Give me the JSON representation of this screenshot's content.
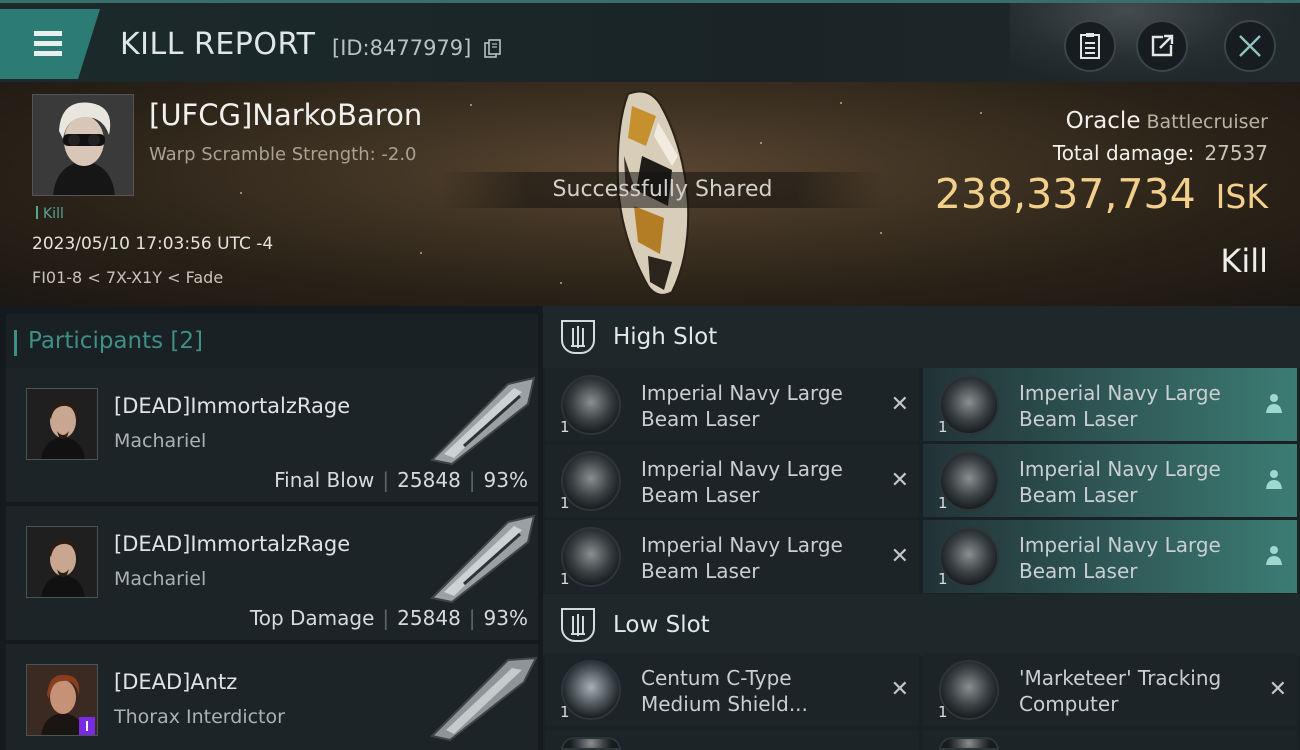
{
  "header": {
    "title": "KILL REPORT",
    "id_text": "[ID:8477979]"
  },
  "victim": {
    "name": "[UFCG]NarkoBaron",
    "warp_scramble": "Warp Scramble Strength: -2.0",
    "tag": "Kill",
    "datetime": "2023/05/10 17:03:56 UTC -4",
    "location": "FI01-8 < 7X-X1Y < Fade",
    "ship": "Oracle",
    "ship_class": "Battlecruiser",
    "total_damage_label": "Total damage:",
    "total_damage": "27537",
    "isk_value": "238,337,734",
    "isk_unit": "ISK",
    "result": "Kill"
  },
  "toast": "Successfully Shared",
  "participants": {
    "title": "Participants",
    "count": "[2]",
    "rows": [
      {
        "name": "[DEAD]ImmortalzRage",
        "ship": "Machariel",
        "role": "Final Blow",
        "damage": "25848",
        "percent": "93%"
      },
      {
        "name": "[DEAD]ImmortalzRage",
        "ship": "Machariel",
        "role": "Top Damage",
        "damage": "25848",
        "percent": "93%"
      },
      {
        "name": "[DEAD]Antz",
        "ship": "Thorax Interdictor"
      }
    ]
  },
  "slots": {
    "high": {
      "title": "High Slot",
      "modules": [
        {
          "qty": "1",
          "line1": "Imperial Navy Large",
          "line2": "Beam Laser",
          "state": "destroyed"
        },
        {
          "qty": "1",
          "line1": "Imperial Navy Large",
          "line2": "Beam Laser",
          "state": "dropped"
        },
        {
          "qty": "1",
          "line1": "Imperial Navy Large",
          "line2": "Beam Laser",
          "state": "destroyed"
        },
        {
          "qty": "1",
          "line1": "Imperial Navy Large",
          "line2": "Beam Laser",
          "state": "dropped"
        },
        {
          "qty": "1",
          "line1": "Imperial Navy Large",
          "line2": "Beam Laser",
          "state": "destroyed"
        },
        {
          "qty": "1",
          "line1": "Imperial Navy Large",
          "line2": "Beam Laser",
          "state": "dropped"
        }
      ]
    },
    "low": {
      "title": "Low Slot",
      "modules": [
        {
          "qty": "1",
          "line1": "Centum C-Type",
          "line2": "Medium Shield...",
          "state": "destroyed"
        },
        {
          "qty": "1",
          "line1": "'Marketeer' Tracking",
          "line2": "Computer",
          "state": "destroyed"
        }
      ]
    }
  },
  "icons": {
    "menu": "hamburger-menu-icon",
    "copy": "copy-icon",
    "clipboard": "clipboard-icon",
    "share": "share-icon",
    "close": "close-icon",
    "destroyed": "x-icon",
    "dropped": "person-icon"
  },
  "colors": {
    "accent": "#2c7c75",
    "isk": "#f2cf8a",
    "participants_title": "#3e8f86"
  }
}
